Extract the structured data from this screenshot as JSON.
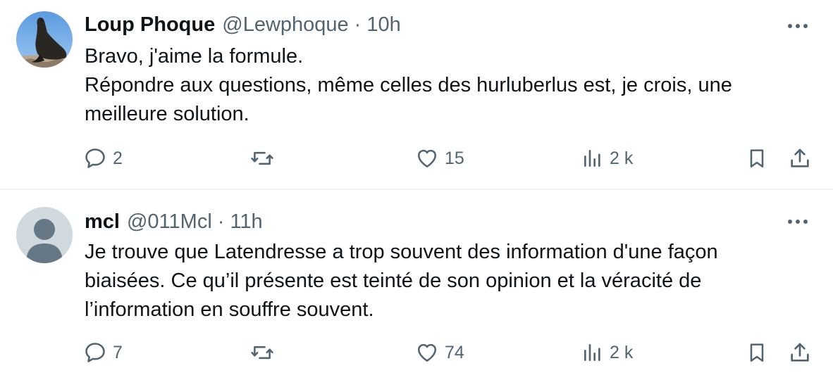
{
  "tweets": [
    {
      "author_name": "Loup Phoque",
      "handle": "@Lewphoque",
      "separator": "·",
      "time": "10h",
      "avatar": "sea-lion-photo",
      "lines": [
        "Bravo, j'aime la formule.",
        "Répondre aux questions, même celles des hurluberlus est, je crois, une",
        "meilleure solution."
      ],
      "replies": "2",
      "reposts": "",
      "likes": "15",
      "views": "2 k"
    },
    {
      "author_name": "mcl",
      "handle": "@011Mcl",
      "separator": "·",
      "time": "11h",
      "avatar": "default-profile-silhouette",
      "lines": [
        "Je trouve que Latendresse a trop souvent des information d'une façon",
        "biaisées. Ce qu’il présente est teinté de son opinion et la véracité de",
        "l’information en souffre souvent."
      ],
      "replies": "7",
      "reposts": "",
      "likes": "74",
      "views": "2 k"
    }
  ],
  "icons": {
    "more": "more-horizontal-icon",
    "reply": "reply-bubble-icon",
    "repost": "repost-arrows-icon",
    "like": "heart-icon",
    "views": "bar-chart-icon",
    "bookmark": "bookmark-icon",
    "share": "share-upload-icon"
  },
  "colors": {
    "text": "#0f1419",
    "secondary": "#536471",
    "divider": "#eff3f4",
    "avatar_default": "#cfd9de"
  }
}
